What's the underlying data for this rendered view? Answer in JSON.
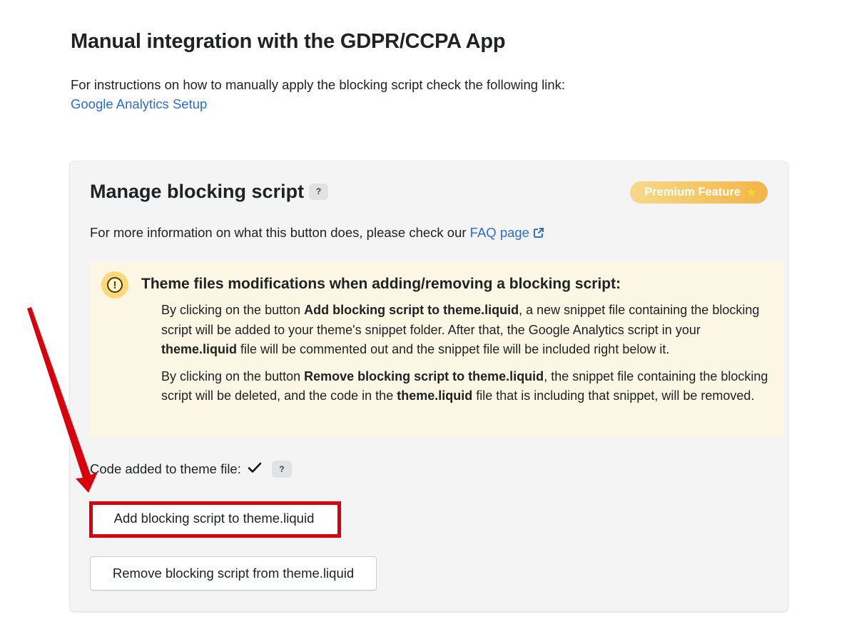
{
  "header": {
    "title": "Manual integration with the GDPR/CCPA App",
    "intro": "For instructions on how to manually apply the blocking script check the following link:",
    "setup_link": "Google Analytics Setup"
  },
  "card": {
    "title": "Manage blocking script",
    "help_badge": "?",
    "premium_label": "Premium Feature",
    "premium_icon": "star-icon",
    "faq_prefix": "For more information on what this button does, please check our ",
    "faq_link": "FAQ page",
    "notice": {
      "icon": "warning-icon",
      "icon_glyph": "!",
      "title": "Theme files modifications when adding/removing a blocking script:",
      "p1_part1": "By clicking on the button ",
      "p1_bold1": "Add blocking script to theme.liquid",
      "p1_part2": ", a new snippet file containing the blocking script will be added to your theme's snippet folder. After that, the Google Analytics script in your ",
      "p1_bold2": "theme.liquid",
      "p1_part3": " file will be commented out and the snippet file will be included right below it.",
      "p2_part1": "By clicking on the button ",
      "p2_bold1": "Remove blocking script to theme.liquid",
      "p2_part2": ", the snippet file containing the blocking script will be deleted, and the code in the ",
      "p2_bold2": "theme.liquid",
      "p2_part3": " file that is including that snippet, will be removed."
    },
    "status_label": "Code added to theme file:",
    "status_help_badge": "?",
    "add_button": "Add blocking script to theme.liquid",
    "remove_button": "Remove blocking script from theme.liquid"
  },
  "colors": {
    "link": "#2c6ecb",
    "card_bg": "#f4f4f4",
    "notice_bg": "#fcf7e4",
    "annotation_red": "#d9000d",
    "premium_gradient_end": "#f3b548"
  }
}
